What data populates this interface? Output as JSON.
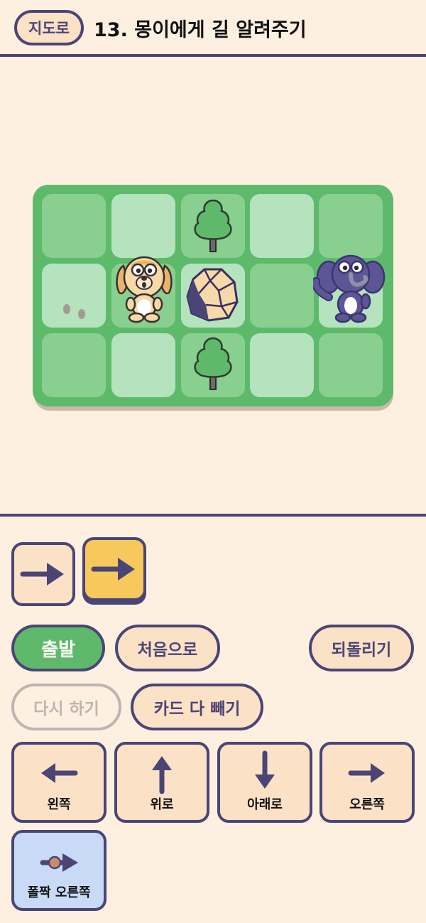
{
  "header": {
    "map_button": "지도로",
    "title": "13. 몽이에게 길 알려주기"
  },
  "board": {
    "rows": 3,
    "cols": 5,
    "objects": [
      {
        "kind": "tree-icon",
        "row": 0,
        "col": 2
      },
      {
        "kind": "dog-character",
        "row": 1,
        "col": 1
      },
      {
        "kind": "rock-icon",
        "row": 1,
        "col": 2
      },
      {
        "kind": "elephant-character",
        "row": 1,
        "col": 4
      },
      {
        "kind": "footprints-icon",
        "row": 1,
        "col": 0
      },
      {
        "kind": "tree-icon",
        "row": 2,
        "col": 2
      }
    ]
  },
  "program": {
    "cards": [
      {
        "icon": "arrow-right-icon",
        "selected": false
      },
      {
        "icon": "arrow-right-icon",
        "selected": true
      }
    ]
  },
  "controls": {
    "start": "출발",
    "reset": "처음으로",
    "undo": "되돌리기",
    "retry": "다시 하기",
    "clear": "카드 다 빼기"
  },
  "palette": {
    "left": "왼쪽",
    "up": "위로",
    "down": "아래로",
    "right": "오른쪽",
    "hop_right": "폴짝 오른쪽"
  },
  "colors": {
    "accent": "#4b4576",
    "card": "#fbe1c6",
    "selected": "#f7c85b",
    "go": "#5fb96a",
    "special": "#c8daf5",
    "board": "#5eba6b"
  }
}
